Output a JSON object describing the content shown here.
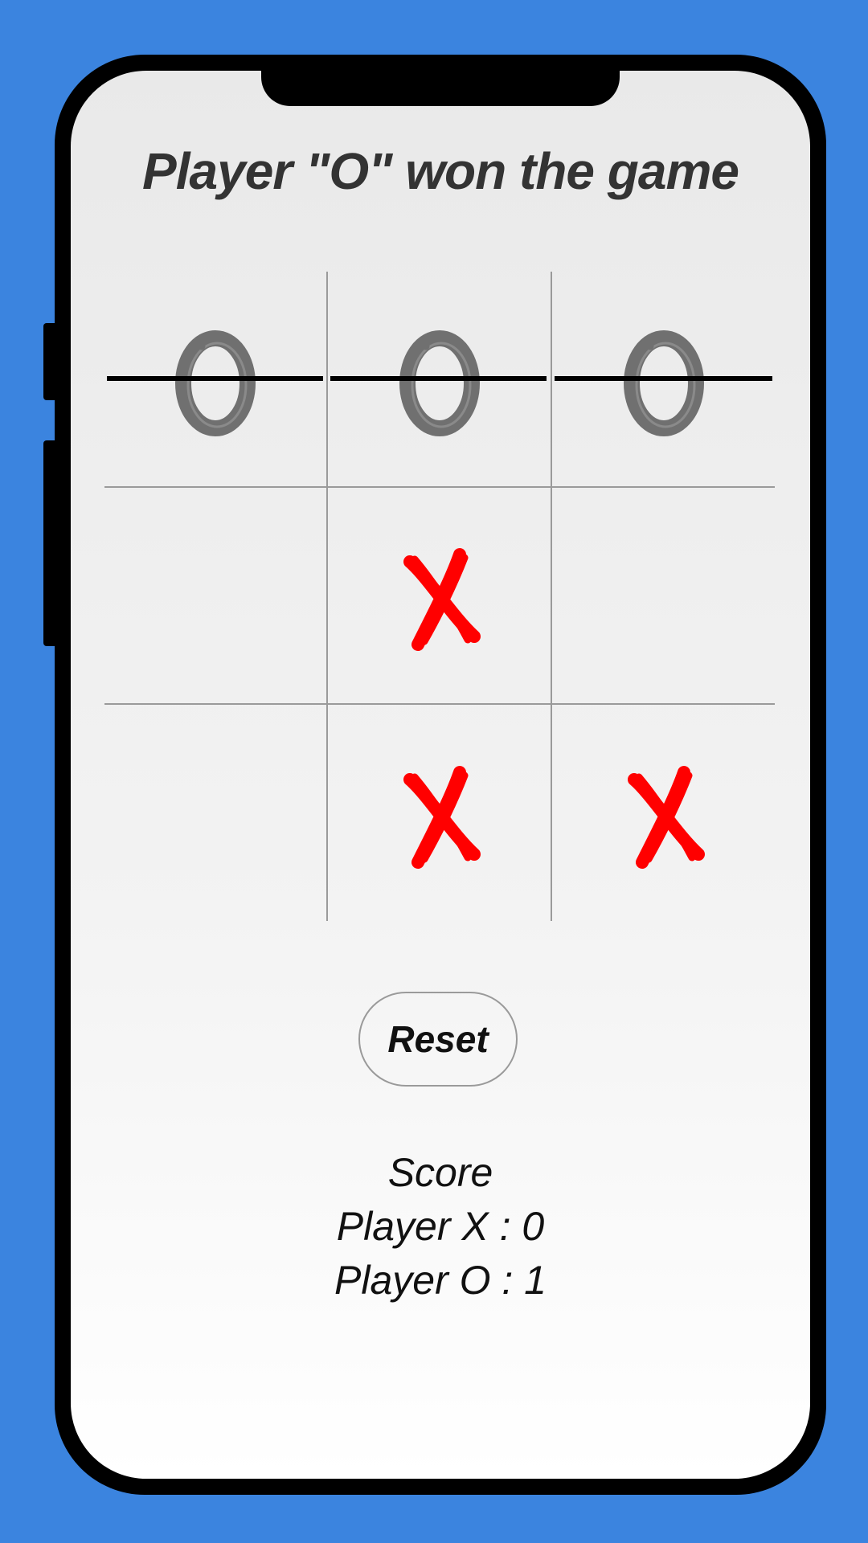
{
  "status_text": "Player \"O\" won the game",
  "board": {
    "cells": [
      "O",
      "O",
      "O",
      "",
      "X",
      "",
      "",
      "X",
      "X"
    ],
    "winning_row": 0
  },
  "reset_label": "Reset",
  "score": {
    "title": "Score",
    "player_x_line": "Player X : 0",
    "player_o_line": "Player O : 1"
  },
  "colors": {
    "background": "#3b84df",
    "x_mark": "#ff0000",
    "o_mark": "#707070",
    "grid": "#9a9a9a"
  },
  "icons": {
    "x": "brush-x-icon",
    "o": "brush-o-icon"
  }
}
